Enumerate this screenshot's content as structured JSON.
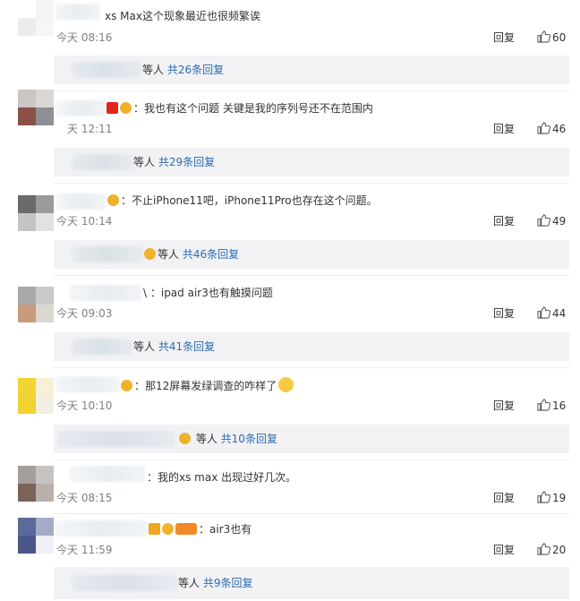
{
  "actions": {
    "reply_label": "回复"
  },
  "comments": [
    {
      "text": "xs Max这个现象最近也很频繁诶",
      "time": "今天 08:16",
      "likes": "60",
      "more_prefix": "等人",
      "more_count": "共26条回复"
    },
    {
      "text": "我也有这个问题 关键是我的序列号还不在范围内",
      "time": "天 12:11",
      "likes": "46",
      "more_prefix": "等人",
      "more_count": "共29条回复"
    },
    {
      "text": "不止iPhone11吧，iPhone11Pro也存在这个问题。",
      "time": "今天 10:14",
      "likes": "49",
      "more_prefix": "等人",
      "more_count": "共46条回复"
    },
    {
      "text": "\\ ：ipad air3也有触摸问题",
      "time": "今天 09:03",
      "likes": "44",
      "more_prefix": "等人",
      "more_count": "共41条回复"
    },
    {
      "text": "那12屏幕发绿调查的咋样了",
      "time": "今天 10:10",
      "likes": "16",
      "more_prefix": "等人",
      "more_count": "共10条回复"
    },
    {
      "text": "我的xs max 出现过好几次。",
      "time": "今天 08:15",
      "likes": "19"
    },
    {
      "text": "air3也有",
      "time": "今天 11:59",
      "likes": "20",
      "more_prefix": "等人",
      "more_count": "共9条回复"
    }
  ]
}
